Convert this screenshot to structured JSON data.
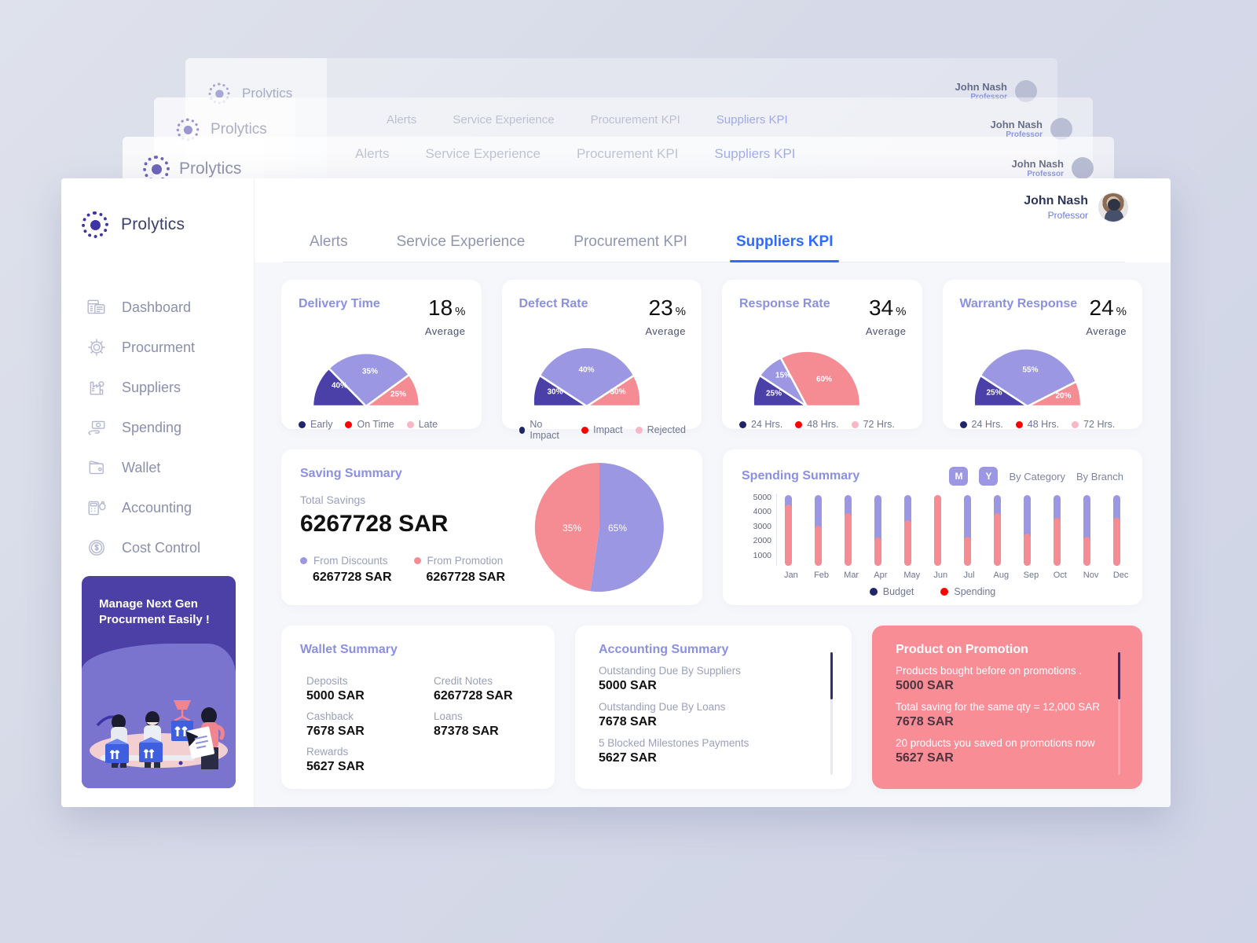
{
  "brand": {
    "name": "Prolytics",
    "logo_icon": "dotted-circle-logo"
  },
  "sidebar": {
    "items": [
      {
        "label": "Dashboard",
        "icon": "dashboard-icon"
      },
      {
        "label": "Procurment",
        "icon": "gear-icon"
      },
      {
        "label": "Suppliers",
        "icon": "factory-icon"
      },
      {
        "label": "Spending",
        "icon": "hand-money-icon"
      },
      {
        "label": "Wallet",
        "icon": "wallet-icon"
      },
      {
        "label": "Accounting",
        "icon": "calculator-money-icon"
      },
      {
        "label": "Cost Control",
        "icon": "dollar-coin-icon"
      }
    ],
    "promo": {
      "line1": "Manage Next Gen",
      "line2": "Procurment Easily !"
    }
  },
  "user": {
    "name": "John Nash",
    "role": "Professor",
    "avatar_icon": "avatar"
  },
  "tabs": [
    {
      "label": "Alerts",
      "active": false
    },
    {
      "label": "Service Experience",
      "active": false
    },
    {
      "label": "Procurement KPI",
      "active": false
    },
    {
      "label": "Suppliers KPI",
      "active": true
    }
  ],
  "colors": {
    "dark_purple": "#4a40a8",
    "mid_purple": "#9b97e3",
    "pink": "#f58b93",
    "accent_blue": "#2f6bff",
    "title_purple": "#8b90e0",
    "legend_red": "#ff0000",
    "legend_navy": "#20246b",
    "legend_pink": "#f8b7c6"
  },
  "kpi_cards": [
    {
      "title": "Delivery Time",
      "value": "18",
      "unit": "%",
      "sub": "Average",
      "legend": [
        {
          "label": "Early",
          "color": "#20246b"
        },
        {
          "label": "On Time",
          "color": "#ff0000"
        },
        {
          "label": "Late",
          "color": "#f8b7c6"
        }
      ],
      "chart_data": {
        "type": "pie",
        "title": "Delivery Time",
        "semicircle": true,
        "labels": [
          "Early",
          "On Time",
          "Late"
        ],
        "values": [
          40,
          35,
          25
        ],
        "colors": [
          "#4a40a8",
          "#9b97e3",
          "#f58b93"
        ]
      }
    },
    {
      "title": "Defect Rate",
      "value": "23",
      "unit": "%",
      "sub": "Average",
      "legend": [
        {
          "label": "No Impact",
          "color": "#20246b"
        },
        {
          "label": "Impact",
          "color": "#ff0000"
        },
        {
          "label": "Rejected",
          "color": "#f8b7c6"
        }
      ],
      "chart_data": {
        "type": "pie",
        "title": "Defect Rate",
        "semicircle": true,
        "labels": [
          "No Impact",
          "Impact",
          "Rejected"
        ],
        "values": [
          30,
          40,
          30
        ],
        "colors": [
          "#4a40a8",
          "#9b97e3",
          "#f58b93"
        ]
      }
    },
    {
      "title": "Response Rate",
      "value": "34",
      "unit": "%",
      "sub": "Average",
      "legend": [
        {
          "label": "24 Hrs.",
          "color": "#20246b"
        },
        {
          "label": "48 Hrs.",
          "color": "#ff0000"
        },
        {
          "label": "72 Hrs.",
          "color": "#f8b7c6"
        }
      ],
      "chart_data": {
        "type": "pie",
        "title": "Response Rate",
        "semicircle": true,
        "labels": [
          "24 Hrs.",
          "48 Hrs.",
          "72 Hrs."
        ],
        "values": [
          25,
          15,
          60
        ],
        "colors": [
          "#4a40a8",
          "#9b97e3",
          "#f58b93"
        ]
      }
    },
    {
      "title": "Warranty Response",
      "value": "24",
      "unit": "%",
      "sub": "Average",
      "legend": [
        {
          "label": "24 Hrs.",
          "color": "#20246b"
        },
        {
          "label": "48 Hrs.",
          "color": "#ff0000"
        },
        {
          "label": "72 Hrs.",
          "color": "#f8b7c6"
        }
      ],
      "chart_data": {
        "type": "pie",
        "title": "Warranty Response",
        "semicircle": true,
        "labels": [
          "24 Hrs.",
          "48 Hrs.",
          "72 Hrs."
        ],
        "values": [
          25,
          55,
          20
        ],
        "colors": [
          "#4a40a8",
          "#9b97e3",
          "#f58b93"
        ]
      }
    }
  ],
  "saving": {
    "title": "Saving Summary",
    "total_label": "Total Savings",
    "total_value": "6267728 SAR",
    "breakdown": [
      {
        "label": "From Discounts",
        "value": "6267728 SAR",
        "color": "#9b97e3"
      },
      {
        "label": "From Promotion",
        "value": "6267728 SAR",
        "color": "#f58b93"
      }
    ],
    "chart_data": {
      "type": "pie",
      "title": "Saving Summary",
      "labels": [
        "From Discounts",
        "From Promotion"
      ],
      "values": [
        65,
        35
      ],
      "colors": [
        "#9b97e3",
        "#f58b93"
      ]
    }
  },
  "spending": {
    "title": "Spending Summary",
    "segments": [
      {
        "label": "M",
        "active": true
      },
      {
        "label": "Y",
        "active": true
      }
    ],
    "controls": [
      {
        "label": "By Category"
      },
      {
        "label": "By Branch"
      }
    ],
    "legend": [
      {
        "label": "Budget",
        "color": "#20246b"
      },
      {
        "label": "Spending",
        "color": "#ff0000"
      }
    ],
    "chart_data": {
      "type": "bar",
      "title": "Spending Summary",
      "categories": [
        "Jan",
        "Feb",
        "Mar",
        "Apr",
        "May",
        "Jun",
        "Jul",
        "Aug",
        "Sep",
        "Oct",
        "Nov",
        "Dec"
      ],
      "ytick_labels": [
        "5000",
        "4000",
        "3000",
        "2000",
        "1000"
      ],
      "ylim": [
        0,
        5400
      ],
      "series": [
        {
          "name": "Budget",
          "color": "#9b97e3",
          "values": [
            5300,
            5300,
            5300,
            5300,
            5300,
            5300,
            5300,
            5300,
            5300,
            5300,
            5300,
            5300
          ]
        },
        {
          "name": "Spending",
          "color": "#f58b93",
          "values": [
            4600,
            3000,
            3950,
            2100,
            3400,
            5300,
            2200,
            3950,
            2400,
            3600,
            2150,
            3600
          ]
        }
      ],
      "xlabel": "",
      "ylabel": "",
      "grid": false,
      "legend_position": "bottom"
    }
  },
  "wallet": {
    "title": "Wallet Summary",
    "left": [
      {
        "label": "Deposits",
        "value": "5000 SAR"
      },
      {
        "label": "Cashback",
        "value": "7678 SAR"
      },
      {
        "label": "Rewards",
        "value": "5627 SAR"
      }
    ],
    "right": [
      {
        "label": "Credit Notes",
        "value": "6267728 SAR"
      },
      {
        "label": "Loans",
        "value": "87378 SAR"
      }
    ]
  },
  "accounting": {
    "title": "Accounting Summary",
    "rows": [
      {
        "label": "Outstanding Due By Suppliers",
        "value": "5000 SAR"
      },
      {
        "label": "Outstanding Due By Loans",
        "value": "7678 SAR"
      },
      {
        "label": "5 Blocked Milestones Payments",
        "value": "5627 SAR"
      }
    ]
  },
  "promotion": {
    "title": "Product on Promotion",
    "rows": [
      {
        "label": "Products bought before on promotions .",
        "value": "5000 SAR"
      },
      {
        "label": "Total saving for the same qty = 12,000 SAR",
        "value": "7678 SAR"
      },
      {
        "label": "20 products you saved on promotions now",
        "value": "5627 SAR"
      }
    ]
  },
  "ghost_windows": {
    "brand": "Prolytics",
    "user_name": "John Nash",
    "user_role": "Professor",
    "tabs": [
      "Alerts",
      "Service Experience",
      "Procurement KPI",
      "Suppliers KPI"
    ],
    "kpi_values": [
      "18 %",
      "23 %",
      "34 %"
    ],
    "kpi_labels": [
      "Delivery Time",
      "Defect Rate",
      "Response Rate",
      "Warranty Response"
    ]
  }
}
